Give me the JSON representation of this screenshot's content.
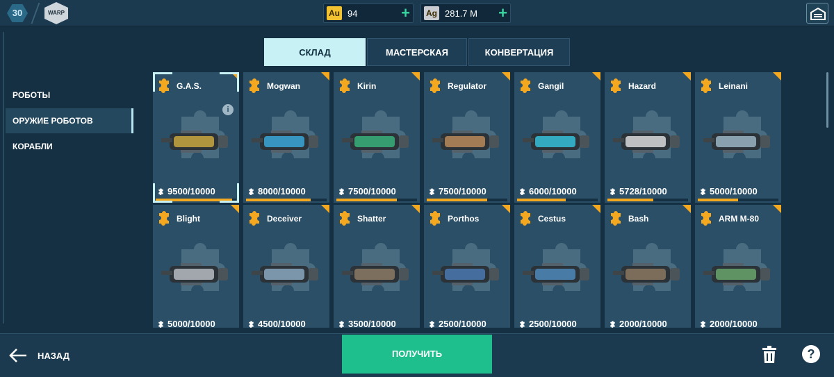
{
  "topbar": {
    "level": "30",
    "rank_label": "WARP",
    "gold": {
      "symbol": "Au",
      "value": "94",
      "color": "#f2c230"
    },
    "silver": {
      "symbol": "Ag",
      "value": "281.7 M",
      "color": "#c9ccd0"
    },
    "plus": "+",
    "hangar_icon": "hangar-icon"
  },
  "tabs": [
    {
      "label": "СКЛАД",
      "active": true
    },
    {
      "label": "МАСТЕРСКАЯ",
      "active": false
    },
    {
      "label": "КОНВЕРТАЦИЯ",
      "active": false
    }
  ],
  "sidebar": {
    "items": [
      {
        "label": "РОБОТЫ",
        "active": false
      },
      {
        "label": "ОРУЖИЕ РОБОТОВ",
        "active": true
      },
      {
        "label": "КОРАБЛИ",
        "active": false
      }
    ]
  },
  "cards": [
    {
      "name": "G.A.S.",
      "count": "9500/10000",
      "progress": 0.95,
      "selected": true,
      "info": "i",
      "color": "#c9a640"
    },
    {
      "name": "Mogwan",
      "count": "8000/10000",
      "progress": 0.8,
      "color": "#3aa7d8"
    },
    {
      "name": "Kirin",
      "count": "7500/10000",
      "progress": 0.75,
      "color": "#38b07a"
    },
    {
      "name": "Regulator",
      "count": "7500/10000",
      "progress": 0.75,
      "color": "#b98a5a"
    },
    {
      "name": "Gangil",
      "count": "6000/10000",
      "progress": 0.6,
      "color": "#35c0d8"
    },
    {
      "name": "Hazard",
      "count": "5728/10000",
      "progress": 0.5728,
      "color": "#d9d9d9"
    },
    {
      "name": "Leinani",
      "count": "5000/10000",
      "progress": 0.5,
      "color": "#9ab4c4"
    },
    {
      "name": "Blight",
      "count": "5000/10000",
      "progress": 0.5,
      "color": "#b6bcc2"
    },
    {
      "name": "Deceiver",
      "count": "4500/10000",
      "progress": 0.45,
      "color": "#8aa7c0"
    },
    {
      "name": "Shatter",
      "count": "3500/10000",
      "progress": 0.35,
      "color": "#8c7a64"
    },
    {
      "name": "Porthos",
      "count": "2500/10000",
      "progress": 0.25,
      "color": "#4a79b0"
    },
    {
      "name": "Cestus",
      "count": "2500/10000",
      "progress": 0.25,
      "color": "#4d88b8"
    },
    {
      "name": "Bash",
      "count": "2000/10000",
      "progress": 0.2,
      "color": "#8b7860"
    },
    {
      "name": "ARM M-80",
      "count": "2000/10000",
      "progress": 0.2,
      "color": "#6aa56c"
    }
  ],
  "bottombar": {
    "back_label": "НАЗАД",
    "get_label": "ПОЛУЧИТЬ",
    "help_label": "?"
  },
  "colors": {
    "accent_orange": "#f3a820",
    "accent_green": "#1ebf8c",
    "tab_active": "#c8f1f6"
  }
}
